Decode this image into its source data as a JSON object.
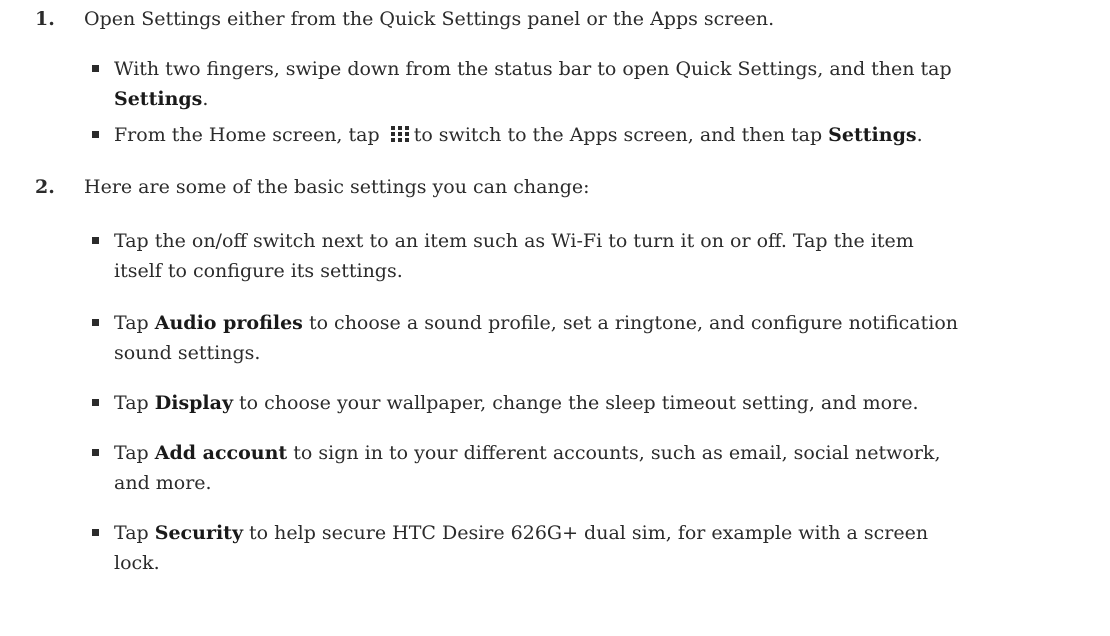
{
  "steps": [
    {
      "number": "1.",
      "text": "Open Settings either from the Quick Settings panel or the Apps screen.",
      "bullets": [
        {
          "line1": "With two fingers, swipe down from the status bar to open Quick Settings, and then tap",
          "bold": "Settings",
          "end": "."
        },
        {
          "pre": "From the Home screen, tap",
          "icon": "apps-grid-icon",
          "mid": "to switch to the Apps screen, and then tap",
          "bold": "Settings",
          "end": "."
        }
      ]
    },
    {
      "number": "2.",
      "text": "Here are some of the basic settings you can change:",
      "bullets": [
        {
          "line1": "Tap the on/off switch next to an item such as Wi-Fi to turn it on or off. Tap the item",
          "line2": "itself to configure its settings."
        },
        {
          "pre": "Tap",
          "bold": "Audio profiles",
          "post": "to choose a sound profile, set a ringtone, and configure notification",
          "line2": "sound settings."
        },
        {
          "pre": "Tap",
          "bold": "Display",
          "post": "to choose your wallpaper, change the sleep timeout setting, and more."
        },
        {
          "pre": "Tap",
          "bold": "Add account",
          "post": "to sign in to your different accounts, such as email, social network,",
          "line2": "and more."
        },
        {
          "pre": "Tap",
          "bold": "Security",
          "post": "to help secure HTC Desire 626G+ dual sim, for example with a screen",
          "line2": "lock."
        }
      ]
    }
  ]
}
